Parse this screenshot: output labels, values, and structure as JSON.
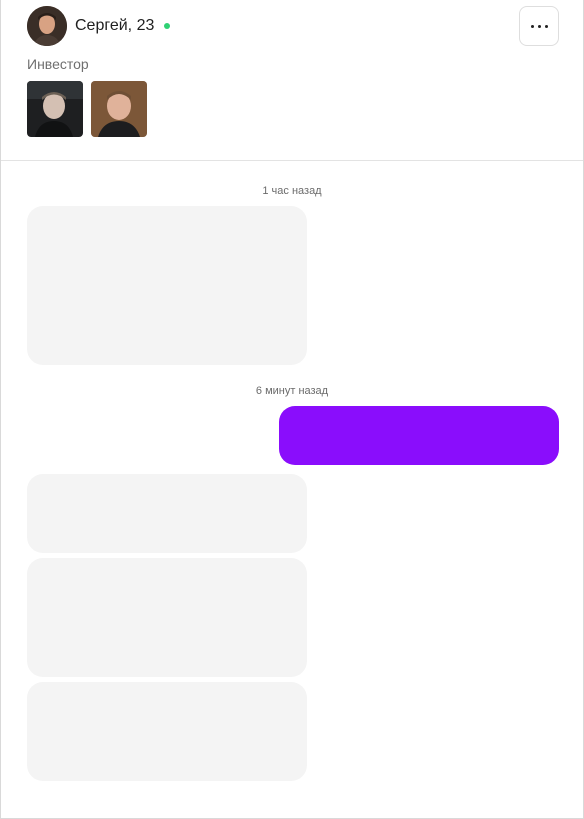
{
  "profile": {
    "name": "Сергей, 23",
    "role": "Инвестор",
    "online": true,
    "online_color": "#2fd174"
  },
  "header": {
    "menu_icon": "more-horizontal-icon",
    "photos_count": 2
  },
  "chat": {
    "groups": [
      {
        "timestamp": "1 час назад",
        "messages": [
          {
            "direction": "incoming",
            "text": ""
          }
        ]
      },
      {
        "timestamp": "6 минут назад",
        "messages": [
          {
            "direction": "outgoing",
            "text": ""
          },
          {
            "direction": "incoming",
            "text": ""
          },
          {
            "direction": "incoming",
            "text": ""
          },
          {
            "direction": "incoming",
            "text": ""
          }
        ]
      }
    ],
    "colors": {
      "incoming_bubble": "#f4f4f4",
      "outgoing_bubble": "#8a0dfc"
    }
  }
}
